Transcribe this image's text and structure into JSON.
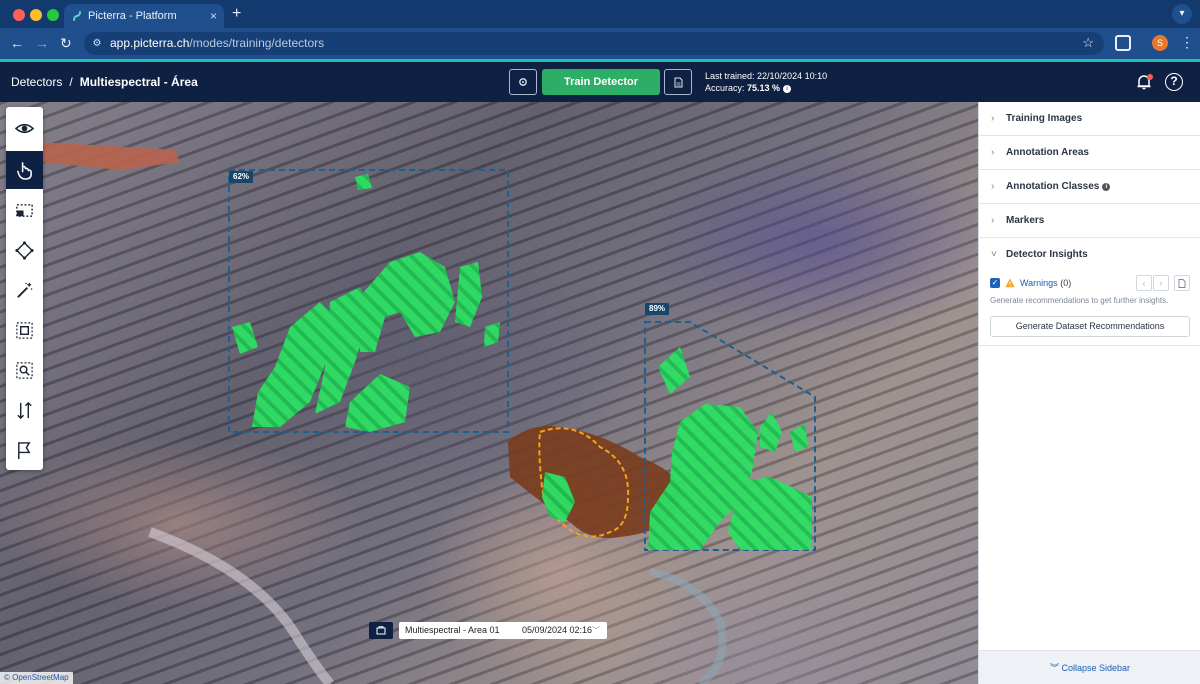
{
  "browser": {
    "tab_title": "Picterra - Platform",
    "url_host": "app.picterra.ch",
    "url_path": "/modes/training/detectors",
    "profile_initial": "S"
  },
  "header": {
    "breadcrumb_root": "Detectors",
    "breadcrumb_separator": "/",
    "breadcrumb_current": "Multiespectral - Área",
    "train_button": "Train Detector",
    "last_trained_label": "Last trained: 22/10/2024 10:10",
    "accuracy_label": "Accuracy:",
    "accuracy_value": "75.13 %"
  },
  "map": {
    "toolbar_tools": [
      "eye-icon",
      "hand-pointer-icon",
      "selection-rectangle-icon",
      "polygon-icon",
      "magic-wand-icon",
      "annotation-area-icon",
      "zoom-area-icon",
      "sort-arrows-icon",
      "flag-icon"
    ],
    "active_tool": "hand-pointer-icon",
    "area_1_accuracy": "62%",
    "area_2_accuracy": "89%",
    "layer_name": "Multiespectral - Area 01",
    "layer_date": "05/09/2024 02:16",
    "attribution": "© OpenStreetMap",
    "colors": {
      "annotation_green": "#2ee063",
      "area_outline": "#1d5f8e",
      "tailings_brown": "#7a3d1e",
      "highlight_orange": "#f3a21c"
    }
  },
  "sidebar": {
    "sections": [
      "Training Images",
      "Annotation Areas",
      "Annotation Classes",
      "Markers",
      "Detector Insights"
    ],
    "warnings_label": "Warnings",
    "warnings_count": "(0)",
    "hint": "Generate recommendations to get further insights.",
    "generate_button": "Generate Dataset Recommendations",
    "collapse_label": "Collapse Sidebar"
  }
}
